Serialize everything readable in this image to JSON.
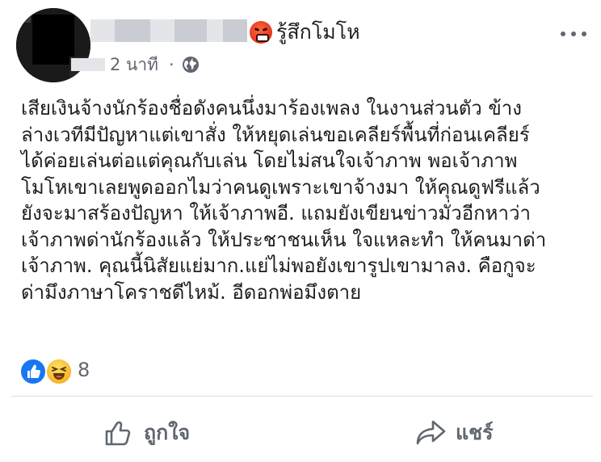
{
  "header": {
    "feeling": "รู้สึกโมโห",
    "feeling_icon": "angry-face-icon",
    "timestamp": "2 นาที",
    "separator": "·",
    "audience_icon": "globe-icon",
    "menu_icon": "more-options-icon"
  },
  "post": {
    "lines": [
      "เสียเงินจ้างนักร้องชื่อดังคนนึ่งมาร้องเพลง ในงานส่วนตัว ข้าง",
      "ล่างเวทีมีปัญหาแต่เขาสั่ง ให้หยุดเล่นขอเคลียร์พื้นที่ก่อนเคลียร์",
      "ได้ค่อยเล่นต่อแต่คุณกับเล่น โดยไม่สนใจเจ้าภาพ  พอเจ้าภาพ",
      "โมโหเขาเลยพูดออกไมว่าคนดูเพราะเขาจ้างมา ให้คุณดูฟรีแล้ว",
      "ยังจะมาสร้องปัญหา ให้เจ้าภาพอี.  แถมยังเขียนข่าวมั่วอีกหาว่า",
      "เจ้าภาพด่านักร้องแล้ว ให้ประชาชนเห็น ใจแหละทำ ให้คนมาด่า",
      "เจ้าภาพ.  คุณนี้นิสัยแย่มาก.แย่ไม่พอยังเขารูปเขามาลง.  คือกูจะ",
      "ด่ามึงภาษาโคราชดีไหม้.  อีดอกพ่อมึงตาย"
    ]
  },
  "reactions": {
    "types": [
      "like",
      "haha"
    ],
    "count": "8",
    "colors": {
      "like": "#1877f2",
      "haha": "#f7b125"
    }
  },
  "actions": {
    "like_label": "ถูกใจ",
    "share_label": "แชร์"
  },
  "colors": {
    "text": "#1c1e21",
    "secondary": "#606770",
    "divider": "#dadde1"
  }
}
